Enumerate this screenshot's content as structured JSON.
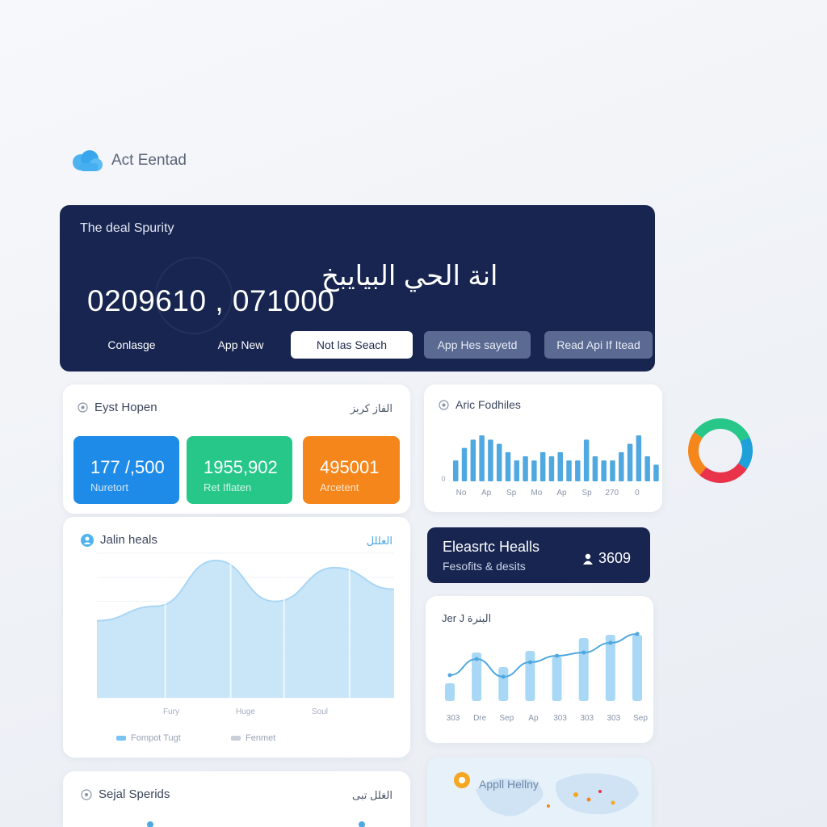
{
  "brand": {
    "name": "Act Eentad",
    "icon": "cloud-icon"
  },
  "hero": {
    "title": "The deal Spurity",
    "number": "0209610 , 071000",
    "arabic": "انة الحي البيايبخ",
    "tabs": [
      {
        "label": "Conlasge"
      },
      {
        "label": "App New"
      },
      {
        "label": "Not las Seach"
      },
      {
        "label": "App Hes sayetd"
      },
      {
        "label": "Read Api If Itead"
      }
    ]
  },
  "overview": {
    "title": "Eyst Hopen",
    "action": "الفاز كربز",
    "kpis": [
      {
        "value": "177 /,500",
        "label": "Nuretort",
        "color": "#1e8be8"
      },
      {
        "value": "1955,902",
        "label": "Ret Iflaten",
        "color": "#27c78a"
      },
      {
        "value": "495001",
        "label": "Arcetent",
        "color": "#f5861b"
      }
    ]
  },
  "area_card": {
    "title": "Jalin heals",
    "action": "العللل",
    "legend": [
      "Fompot Tugt",
      "Fenmet"
    ]
  },
  "bars_card": {
    "title": "Aric Fodhiles"
  },
  "donut": {
    "colors": [
      "#f5861b",
      "#27c78a",
      "#1ea0d8",
      "#e8334b"
    ]
  },
  "dark_card": {
    "title": "Eleasrtc Healls",
    "subtitle": "Fesofits & desits",
    "count": "3609",
    "icon": "user-icon"
  },
  "combo_card": {
    "title": "Jer J البنرة"
  },
  "bottom_left": {
    "title": "Sejal Sperids",
    "action": "الغلل تبى"
  },
  "bottom_right": {
    "title": "Appll Hellny",
    "icon": "location-pin-icon"
  },
  "chart_data": [
    {
      "type": "area",
      "title": "Jalin heals",
      "x": [
        "Fury",
        "Huge",
        "Soul"
      ],
      "legend": [
        "Fompot Tugt",
        "Fenmet"
      ],
      "values": [
        32,
        38,
        57,
        40,
        54,
        45
      ],
      "ylim": [
        0,
        60
      ]
    },
    {
      "type": "bar",
      "title": "Aric Fodhiles",
      "categories": [
        "No",
        "Ap",
        "Sp",
        "Mo",
        "Ap",
        "Sp",
        "270",
        "0"
      ],
      "values": [
        5,
        8,
        10,
        11,
        10,
        9,
        7,
        5,
        6,
        5,
        7,
        6,
        7,
        5,
        5,
        10,
        6,
        5,
        5,
        7,
        9,
        11,
        6,
        4
      ],
      "ylim": [
        0,
        12
      ]
    },
    {
      "type": "bar",
      "title": "Jer J البنرة",
      "categories": [
        "303",
        "Dre",
        "Sep",
        "Ap",
        "303",
        "303",
        "303",
        "Sep"
      ],
      "values": [
        22,
        60,
        42,
        62,
        55,
        78,
        82,
        82
      ],
      "line": [
        32,
        52,
        30,
        48,
        56,
        60,
        72,
        83
      ],
      "ylim": [
        0,
        100
      ]
    }
  ]
}
